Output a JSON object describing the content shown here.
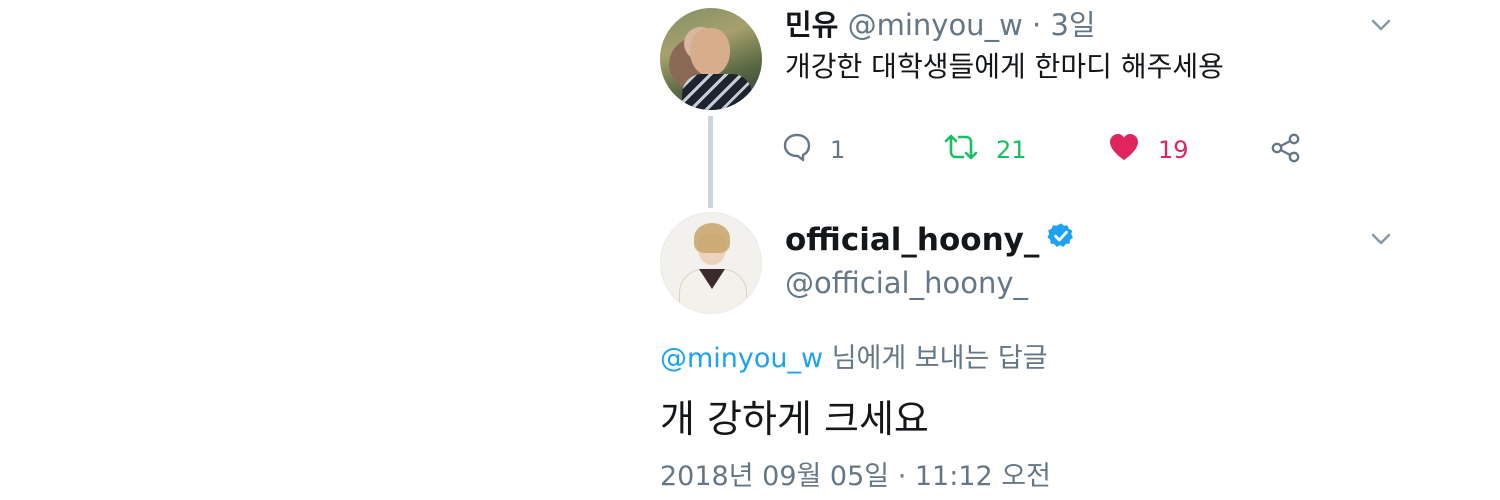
{
  "tweet1": {
    "display_name": "민유",
    "handle": "@minyou_w",
    "separator": "·",
    "time_ago": "3일",
    "text": "개강한 대학생들에게 한마디 해주세용",
    "actions": {
      "reply_count": "1",
      "retweet_count": "21",
      "like_count": "19"
    }
  },
  "tweet2": {
    "display_name": "official_hoony_",
    "handle": "@official_hoony_",
    "verified": true,
    "reply_to_mention": "@minyou_w",
    "reply_to_suffix": " 님에게 보내는 답글",
    "text": "개 강하게 크세요",
    "timestamp": "2018년 09월 05일 · 11:12 오전"
  },
  "colors": {
    "retweet": "#17bf63",
    "like": "#e0245e",
    "mention": "#1da1f2",
    "muted": "#657786",
    "verified": "#1da1f2"
  },
  "icons": {
    "reply": "reply-icon",
    "retweet": "retweet-icon",
    "like": "heart-icon",
    "share": "share-icon",
    "caret": "chevron-down-icon",
    "verified": "verified-badge-icon"
  }
}
